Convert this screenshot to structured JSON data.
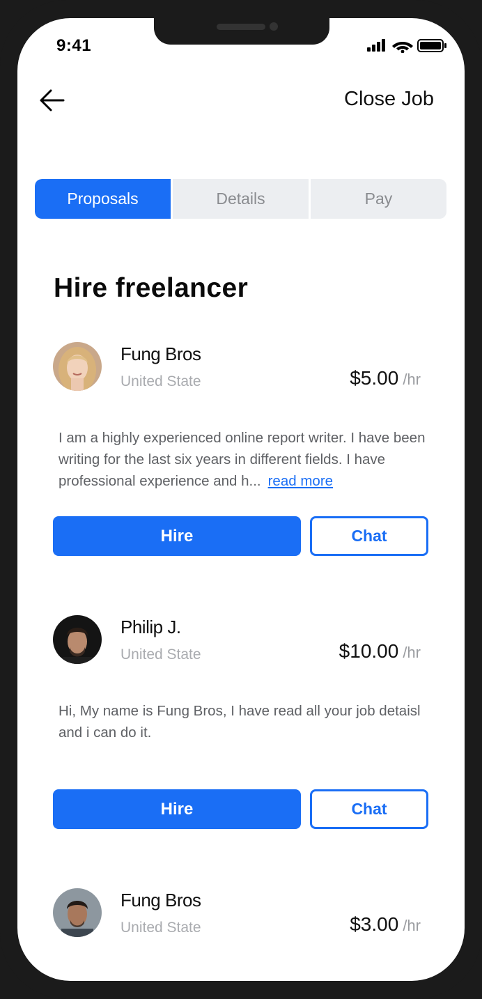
{
  "status_bar": {
    "time": "9:41",
    "icons": [
      "signal-icon",
      "wifi-icon",
      "battery-icon"
    ]
  },
  "header": {
    "back_icon": "arrow-left-icon",
    "close_job": "Close Job"
  },
  "tabs": [
    {
      "label": "Proposals",
      "active": true
    },
    {
      "label": "Details",
      "active": false
    },
    {
      "label": "Pay",
      "active": false
    }
  ],
  "title": "Hire freelancer",
  "freelancers": [
    {
      "name": "Fung Bros",
      "location": "United State",
      "rate": "$5.00",
      "per": "/hr",
      "description": "I am a highly experienced online report writer. I have been writing for the last six years in different fields. I have professional experience and h...",
      "read_more": "read more",
      "hire": "Hire",
      "chat": "Chat"
    },
    {
      "name": "Philip J.",
      "location": "United State",
      "rate": "$10.00",
      "per": "/hr",
      "description": "Hi, My name is Fung Bros, I have read all your job detaisl and i can do it.",
      "hire": "Hire",
      "chat": "Chat"
    },
    {
      "name": "Fung Bros",
      "location": "United State",
      "rate": "$3.00",
      "per": "/hr"
    }
  ],
  "colors": {
    "accent": "#1a6ef5",
    "muted_text": "#a9abaf",
    "tab_bg": "#eceef1"
  }
}
